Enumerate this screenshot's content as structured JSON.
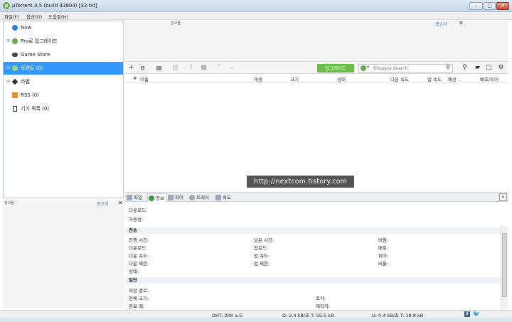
{
  "window": {
    "title": "µTorrent 3.5  (build 43804) [32-bit]",
    "logo": "µ",
    "min": "–",
    "max": "□",
    "close": "✕"
  },
  "menu": [
    "파일(F)",
    "옵션(O)",
    "도움말(H)"
  ],
  "sidebar": {
    "items": [
      {
        "label": "Now",
        "icon": "bundle-icon"
      },
      {
        "label": "Pro로 업그레이드",
        "icon": "utorrent-icon",
        "expander": "⊞"
      },
      {
        "label": "Game Store",
        "icon": "gamepad-icon"
      },
      {
        "label": "토렌트 (0)",
        "icon": "torrents-icon",
        "expander": "⊟"
      },
      {
        "label": "라벨",
        "icon": "label-icon",
        "expander": "⊞"
      },
      {
        "label": "RSS (0)",
        "icon": "rss-icon"
      },
      {
        "label": "기기 목록 (0)",
        "icon": "device-icon"
      }
    ]
  },
  "ad_top": {
    "label": "광고물",
    "report": "광고서",
    "close": "✕"
  },
  "toolbar": {
    "upgrade": "업그레이드",
    "search_placeholder": "Bitspace Search",
    "search_dropdown": "▾"
  },
  "columns": [
    "#",
    "이름",
    "재생",
    "크기",
    "상태",
    "다운 속도",
    "업 속도",
    "예상 ..",
    "배포/피어"
  ],
  "watermark": "http://nextcom.tistory.com",
  "tabs": [
    "파일",
    "정보",
    "피어",
    "트래커",
    "속도"
  ],
  "ad_left": {
    "label": "광고물",
    "report": "광고서",
    "close": "✕"
  },
  "info": {
    "top": [
      "다운로드:",
      "가용성:"
    ],
    "transfer_title": "전송",
    "transfer_col1": [
      "진행 시간:",
      "다운로드:",
      "다운 속도:",
      "다운 제한:",
      "상태:"
    ],
    "transfer_col2": [
      "남은 시간:",
      "업로드:",
      "업 속도:",
      "업 제한:"
    ],
    "transfer_col3": [
      "버림:",
      "배포:",
      "피어:",
      "비율:"
    ],
    "general_title": "일반",
    "general_col1": [
      "저장 경로:",
      "전체 크기:",
      "완료 때:"
    ],
    "general_col2": [
      "조각:",
      "제작자:"
    ]
  },
  "status": {
    "dht": "DHT: 208 노드",
    "down": "D: 2.4 kB/초 T: 55.5 kB",
    "up": "U: 0.4 kB/초 T: 18.8 kB",
    "fb": "f",
    "tw": "🐦"
  }
}
